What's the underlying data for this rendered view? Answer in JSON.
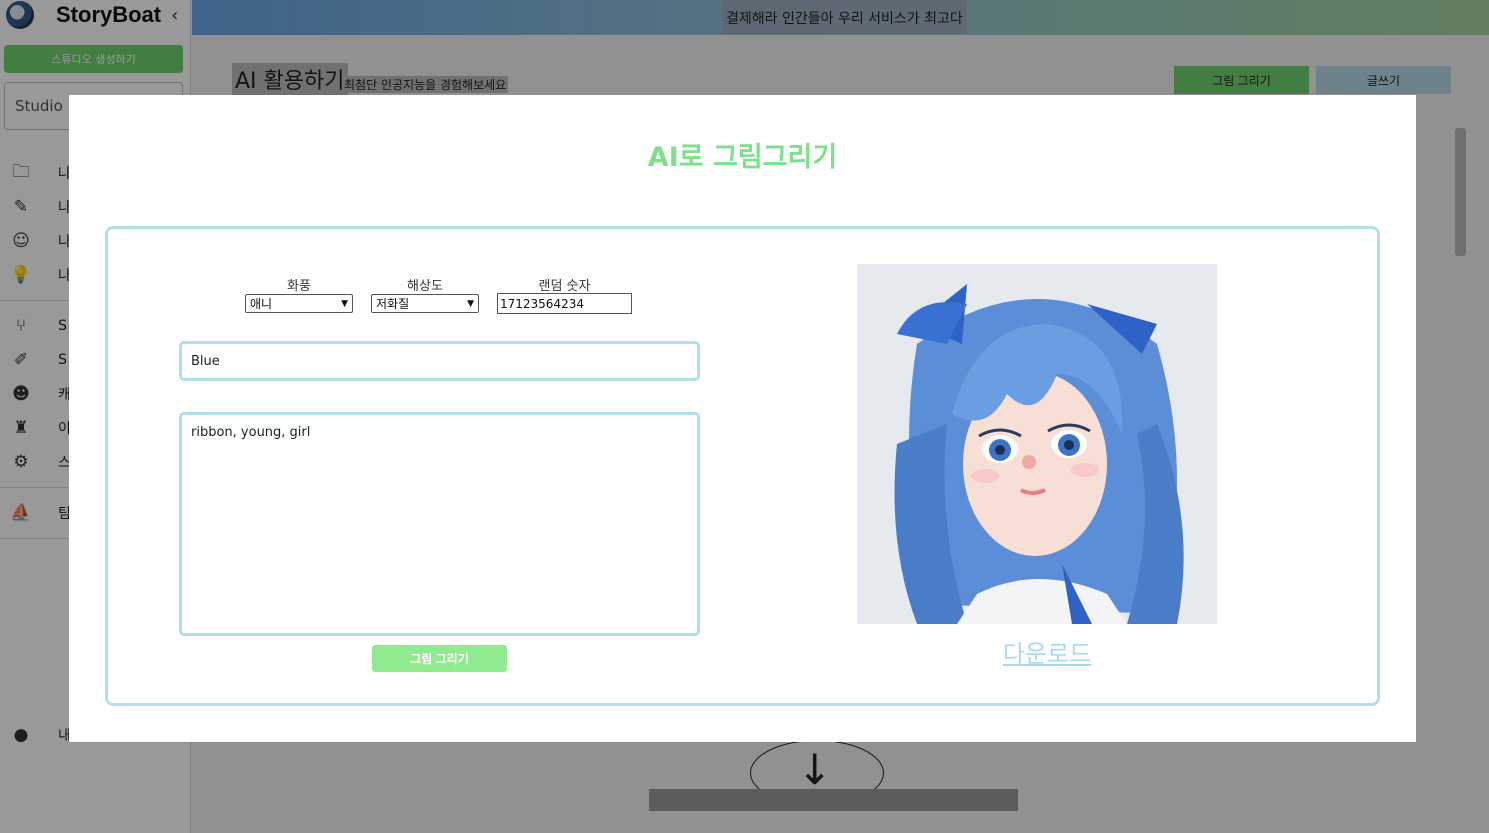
{
  "sidebar": {
    "brand_name": "StoryBoat",
    "create_studio_label": "스튜디오 생성하기",
    "studio_placeholder": "Studio",
    "menu_group1": [
      {
        "icon": "folder-icon",
        "glyph": "🗀",
        "label": "나"
      },
      {
        "icon": "pencil-icon",
        "glyph": "✎",
        "label": "나"
      },
      {
        "icon": "smiley-add-icon",
        "glyph": "☺",
        "label": "나"
      },
      {
        "icon": "lightbulb-icon",
        "glyph": "💡",
        "label": "나"
      }
    ],
    "menu_group2": [
      {
        "icon": "branch-icon",
        "glyph": "⑂",
        "label": "S"
      },
      {
        "icon": "edit-icon",
        "glyph": "✐",
        "label": "S"
      },
      {
        "icon": "face-icon",
        "glyph": "☻",
        "label": "캐"
      },
      {
        "icon": "robot-icon",
        "glyph": "♜",
        "label": "이"
      },
      {
        "icon": "gear-icon",
        "glyph": "⚙",
        "label": "스"
      }
    ],
    "menu_group3": [
      {
        "icon": "boat-icon",
        "glyph": "⛵",
        "label": "팀"
      }
    ],
    "account": {
      "icon": "account-icon",
      "glyph": "●",
      "label": "내"
    }
  },
  "topbar": {
    "ad_text": "결제해라 인간들아 우리 서비스가 최고다"
  },
  "page": {
    "title": "AI 활용하기",
    "subtitle": "최첨단 인공지능을 경험해보세요",
    "tab_draw": "그림 그리기",
    "tab_write": "글쓰기"
  },
  "modal": {
    "title": "AI로 그림그리기",
    "style_label": "화풍",
    "style_value": "애니",
    "resolution_label": "해상도",
    "resolution_value": "저화질",
    "seed_label": "랜덤 숫자",
    "seed_value": "17123564234",
    "prompt_value": "Blue",
    "detail_value": "ribbon, young, girl",
    "generate_label": "그림 그리기",
    "download_label": "다운로드"
  },
  "colors": {
    "accent_green": "#7ee08a",
    "border_blue": "#b3dfe6",
    "button_green": "#90ea90"
  }
}
